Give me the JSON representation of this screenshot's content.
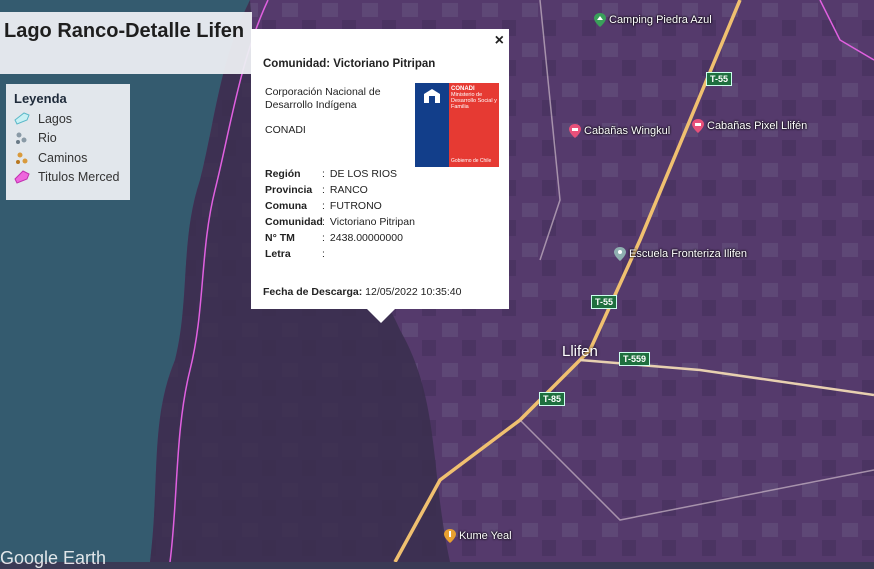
{
  "map": {
    "title": "Lago Ranco-Detalle Lifen",
    "watermark": "Google Earth"
  },
  "legend": {
    "heading": "Leyenda",
    "items": [
      {
        "label": "Lagos",
        "icon": "lake-icon",
        "color": "#8ad8e8"
      },
      {
        "label": "Rio",
        "icon": "river-icon",
        "color": "#7a8a96"
      },
      {
        "label": "Caminos",
        "icon": "roads-icon",
        "color": "#d99a3c"
      },
      {
        "label": "Titulos Merced",
        "icon": "merced-icon",
        "color": "#ee66dd"
      }
    ]
  },
  "popup": {
    "close_label": "×",
    "title": "Comunidad: Victoriano Pitripan",
    "org_name": "Corporación Nacional de Desarrollo Indígena",
    "org_acronym": "CONADI",
    "logo": {
      "brand": "CONADI",
      "ministry": "Ministerio de Desarrollo Social y Familia",
      "gov": "Gobierno de Chile"
    },
    "fields": [
      {
        "key": "Región",
        "value": "DE LOS RIOS"
      },
      {
        "key": "Provincia",
        "value": "RANCO"
      },
      {
        "key": "Comuna",
        "value": "FUTRONO"
      },
      {
        "key": "Comunidad",
        "value": "Victoriano Pitripan"
      },
      {
        "key": "N° TM",
        "value": "2438.00000000"
      },
      {
        "key": "Letra",
        "value": ""
      }
    ],
    "download_label": "Fecha de Descarga:",
    "download_value": "12/05/2022 10:35:40"
  },
  "places": [
    {
      "name": "Camping Piedra Azul",
      "icon": "camping-icon",
      "color": "#3aa05a"
    },
    {
      "name": "Cabañas Wingkul",
      "icon": "lodging-icon",
      "color": "#e8507a"
    },
    {
      "name": "Cabañas Pixel Llifén",
      "icon": "lodging-icon",
      "color": "#e8507a"
    },
    {
      "name": "Escuela Fronteriza Ilifen",
      "icon": "school-icon",
      "color": "#7fa0a0"
    },
    {
      "name": "Kume Yeal",
      "icon": "food-icon",
      "color": "#e8a030"
    }
  ],
  "town": "Llifen",
  "roads": [
    "T-55",
    "T-55",
    "T-559",
    "T-85"
  ],
  "colors": {
    "lake": "#355c70",
    "overlay": "#6a3f7e",
    "boundary": "#e060e0",
    "road": "#f0c070"
  }
}
